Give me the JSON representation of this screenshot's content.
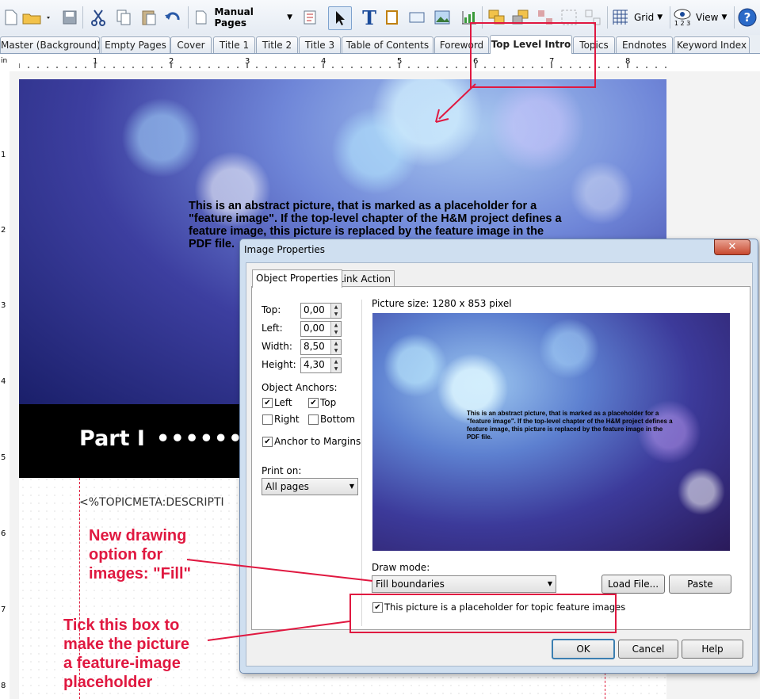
{
  "toolbar": {
    "manual_pages_label": "Manual Pages",
    "grid_label": "Grid",
    "view_label": "View",
    "view_sub": "1 2 3"
  },
  "tabs": [
    {
      "label": "Master (Background)"
    },
    {
      "label": "Empty Pages"
    },
    {
      "label": "Cover"
    },
    {
      "label": "Title 1"
    },
    {
      "label": "Title 2"
    },
    {
      "label": "Title 3"
    },
    {
      "label": "Table of Contents"
    },
    {
      "label": "Foreword"
    },
    {
      "label": "Top Level Intro",
      "active": true
    },
    {
      "label": "Topics"
    },
    {
      "label": "Endnotes"
    },
    {
      "label": "Keyword Index"
    }
  ],
  "ruler": {
    "unit": "in",
    "h_numbers": [
      "1",
      "2",
      "3",
      "4",
      "5",
      "6",
      "7",
      "8"
    ],
    "v_numbers": [
      "1",
      "2",
      "3",
      "4",
      "5",
      "6",
      "7",
      "8"
    ]
  },
  "page": {
    "hero_text": "This is an abstract picture, that is marked as a placeholder for a \"feature image\". If the top-level chapter of the H&M project defines a feature image, this picture is replaced by the feature image in the PDF file.",
    "part_title": "Part I",
    "part_dots": "••••••••••••",
    "topicmeta": "<%TOPICMETA:DESCRIPTI"
  },
  "annotations": {
    "fill_note": "New drawing option for images: \"Fill\"",
    "fill_note_lines": [
      "New drawing",
      "option for",
      "images: \"Fill\""
    ],
    "tick_note_lines": [
      "Tick this box to",
      "make the picture",
      "a feature-image",
      "placeholder"
    ]
  },
  "dialog": {
    "title": "Image Properties",
    "close_glyph": "✕",
    "tabs": [
      "Object Properties",
      "Link Action"
    ],
    "fields": {
      "top_label": "Top:",
      "top_value": "0,00",
      "left_label": "Left:",
      "left_value": "0,00",
      "width_label": "Width:",
      "width_value": "8,50",
      "height_label": "Height:",
      "height_value": "4,30"
    },
    "anchors": {
      "heading": "Object Anchors:",
      "left": "Left",
      "left_checked": true,
      "top": "Top",
      "top_checked": true,
      "right": "Right",
      "right_checked": false,
      "bottom": "Bottom",
      "bottom_checked": false,
      "margins": "Anchor to Margins",
      "margins_checked": true
    },
    "print_on": {
      "label": "Print on:",
      "value": "All pages"
    },
    "picture_size": "Picture size: 1280 x 853 pixel",
    "preview_text": "This is an abstract picture, that is marked as a placeholder for a \"feature image\". If the top-level chapter of the H&M project defines a feature image, this picture is replaced by the feature image in the PDF file.",
    "draw_mode": {
      "label": "Draw mode:",
      "value": "Fill boundaries"
    },
    "load_file": "Load File...",
    "paste": "Paste",
    "placeholder_checkbox": "This picture is a placeholder for topic feature images",
    "placeholder_checked": true,
    "ok": "OK",
    "cancel": "Cancel",
    "help": "Help"
  },
  "colors": {
    "annotation": "#e01840"
  }
}
